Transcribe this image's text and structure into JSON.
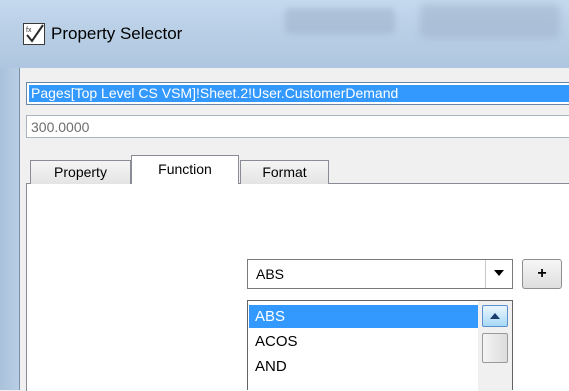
{
  "window": {
    "title": "Property Selector",
    "icon": "fx-checkmark-icon"
  },
  "formula": {
    "value": "Pages[Top Level CS VSM]!Sheet.2!User.CustomerDemand"
  },
  "result": {
    "value": "300.0000"
  },
  "tabs": [
    {
      "label": "Property"
    },
    {
      "label": "Function",
      "active": true
    },
    {
      "label": "Format"
    }
  ],
  "function_select": {
    "value": "ABS"
  },
  "insert_button": {
    "label": "+"
  },
  "function_list": {
    "items": [
      {
        "label": "ABS",
        "selected": true
      },
      {
        "label": "ACOS"
      },
      {
        "label": "AND"
      }
    ]
  },
  "colors": {
    "selection": "#3399ff",
    "titlebar": "#b9cfe6"
  }
}
